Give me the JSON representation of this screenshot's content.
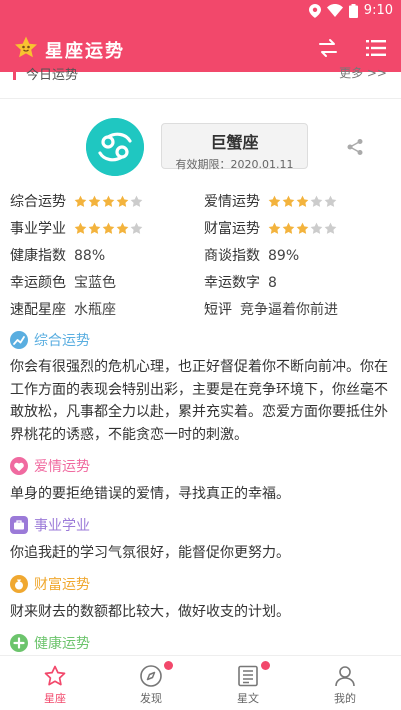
{
  "status_bar": {
    "time": "9:10"
  },
  "app_bar": {
    "title": "星座运势"
  },
  "today": {
    "label": "今日运势",
    "more": "更多 >>"
  },
  "sign": {
    "name": "巨蟹座",
    "valid": "有效期限：2020.01.11"
  },
  "ratings": [
    {
      "label": "综合运势",
      "stars": 4
    },
    {
      "label": "爱情运势",
      "stars": 3
    },
    {
      "label": "事业学业",
      "stars": 4
    },
    {
      "label": "财富运势",
      "stars": 3
    }
  ],
  "facts": {
    "health_label": "健康指数",
    "health_value": "88%",
    "business_label": "商谈指数",
    "business_value": "89%",
    "color_label": "幸运颜色",
    "color_value": "宝蓝色",
    "number_label": "幸运数字",
    "number_value": "8",
    "match_label": "速配星座",
    "match_value": "水瓶座",
    "comment_label": "短评",
    "comment_value": "竞争逼着你前进"
  },
  "sections": {
    "overall": {
      "title": "综合运势",
      "text": "你会有很强烈的危机心理，也正好督促着你不断向前冲。你在工作方面的表现会特别出彩，主要是在竞争环境下，你丝毫不敢放松，凡事都全力以赴，累并充实着。恋爱方面你要抵住外界桃花的诱惑，不能贪恋一时的刺激。",
      "color": "#5aaee0"
    },
    "love": {
      "title": "爱情运势",
      "text": "单身的要拒绝错误的爱情，寻找真正的幸福。",
      "color": "#f06aa0"
    },
    "career": {
      "title": "事业学业",
      "text": "你追我赶的学习气氛很好，能督促你更努力。",
      "color": "#9b7ad8"
    },
    "wealth": {
      "title": "财富运势",
      "text": "财来财去的数额都比较大，做好收支的计划。",
      "color": "#f0a830"
    },
    "health": {
      "title": "健康运势",
      "color": "#6cc46c"
    }
  },
  "nav": [
    {
      "label": "星座",
      "active": true
    },
    {
      "label": "发现"
    },
    {
      "label": "星文"
    },
    {
      "label": "我的"
    }
  ],
  "colors": {
    "accent": "#f2486b",
    "star_on": "#f3b33d",
    "star_off": "#cccccc",
    "sign_bg": "#1fc7c1"
  },
  "icons": [
    "location-icon",
    "wifi-icon",
    "battery-icon",
    "logo-star-icon",
    "swap-icon",
    "menu-icon",
    "cancer-sign-icon",
    "share-icon",
    "star-icon",
    "compass-icon",
    "document-icon",
    "person-icon"
  ]
}
